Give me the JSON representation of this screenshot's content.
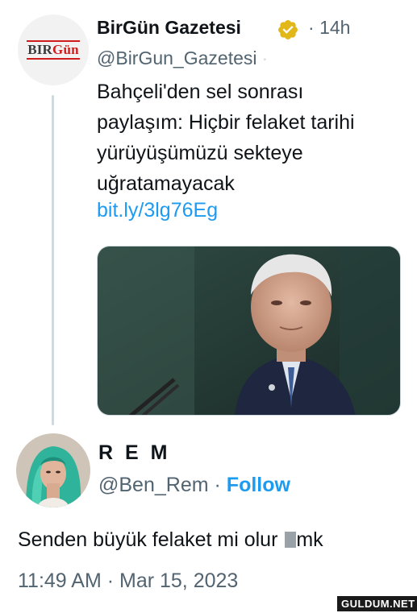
{
  "quoted_tweet": {
    "avatar_logo": {
      "part1": "BIR",
      "part2": "Gün"
    },
    "display_name": "BirGün Gazetesi",
    "verified_badge": "verified-icon",
    "time_separator": "·",
    "time": "14h",
    "handle": "@BirGun_Gazetesi",
    "text_lines": [
      "Bahçeli'den sel sonrası",
      "paylaşım: Hiçbir felaket tarihi",
      "yürüyüşümüzü sekteye",
      "uğratamayacak"
    ],
    "link": "bit.ly/3lg76Eg",
    "media": "photo"
  },
  "main_tweet": {
    "display_name": "R E M",
    "handle": "@Ben_Rem",
    "separator": "·",
    "follow_label": "Follow",
    "text_before": "Senden büyük felaket mi olur ",
    "text_after": "mk",
    "timestamp": "11:49 AM · Mar 15, 2023"
  },
  "watermark": "GULDUM.NET",
  "colors": {
    "link": "#1d9bf0",
    "secondary_text": "#536471",
    "verified_gold": "#e2b719",
    "brand_red": "#cf1d1d"
  }
}
